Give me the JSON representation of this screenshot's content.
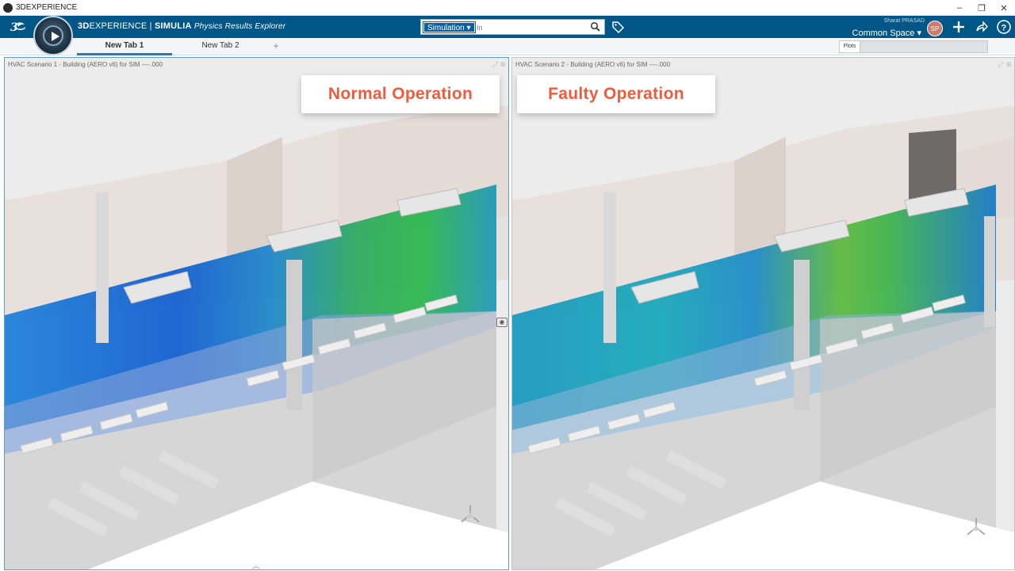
{
  "window": {
    "title": "3DEXPERIENCE",
    "buttons": [
      "–",
      "❐",
      "✕"
    ]
  },
  "topbar": {
    "brand_main": "3D",
    "brand_light": "EXPERIENCE",
    "brand_sep": " | ",
    "brand_product": "SIMULIA",
    "app_name": "Physics Results Explorer",
    "search": {
      "scope": "Simulation ▾",
      "placeholder": "In"
    },
    "user_name": "Sharat PRASAD",
    "space": "Common Space ▾",
    "avatar_initials": "SP",
    "colors": {
      "bar": "#005686",
      "accent": "#2c78b5"
    }
  },
  "tabs": [
    {
      "label": "New Tab 1",
      "active": true
    },
    {
      "label": "New Tab 2",
      "active": false
    },
    {
      "label": "+",
      "active": false
    }
  ],
  "plots_panel": {
    "label": "Plots"
  },
  "panels": {
    "left": {
      "title": "HVAC Scenario 1 - Building (AERO v6) for SIM ----.000",
      "overlay_label": "Normal Operation"
    },
    "right": {
      "title": "HVAC Scenario 2 - Building (AERO v6) for SIM ----.000",
      "overlay_label": "Faulty Operation"
    }
  },
  "icons": {
    "ds_logo": "3ds-logo-icon",
    "compass": "compass-icon",
    "search": "search-icon",
    "tag": "tag-icon",
    "add": "plus-icon",
    "share": "share-icon",
    "help": "help-icon",
    "camera": "camera-icon",
    "triad": "triad-icon"
  }
}
